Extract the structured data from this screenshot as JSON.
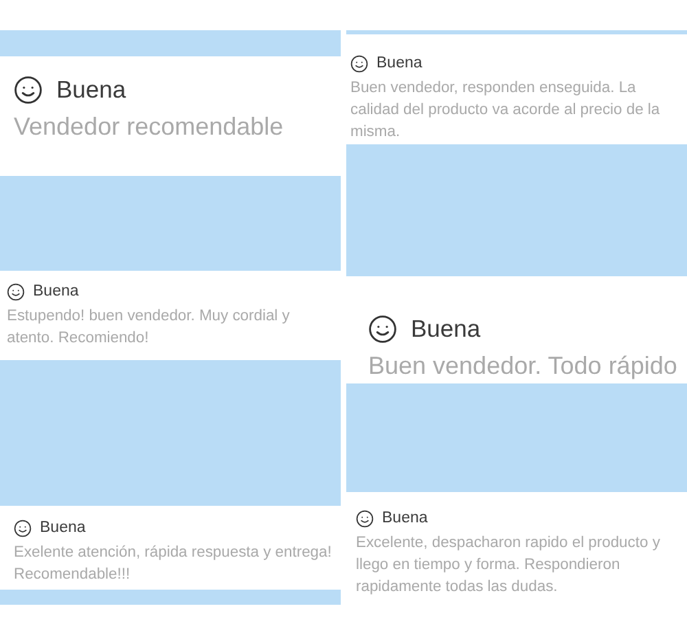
{
  "columns": [
    {
      "reviews": [
        {
          "kind": "large",
          "rating": "Buena",
          "comment": "Vendedor recomendable"
        },
        {
          "kind": "small",
          "rating": "Buena",
          "comment": "Estupendo! buen vendedor. Muy cordial y atento. Recomiendo!"
        },
        {
          "kind": "small",
          "rating": "Buena",
          "comment": "Exelente atención, rápida respuesta y entrega! Recomendable!!!"
        }
      ]
    },
    {
      "reviews": [
        {
          "kind": "small",
          "rating": "Buena",
          "comment": "Buen vendedor, responden enseguida. La calidad del producto va acorde al precio de la misma."
        },
        {
          "kind": "large",
          "rating": "Buena",
          "comment": "Buen vendedor. Todo rápido"
        },
        {
          "kind": "small",
          "rating": "Buena",
          "comment": "Excelente, despacharon rapido el producto y llego en tiempo y forma. Respondieron rapidamente todas las dudas."
        }
      ]
    }
  ]
}
